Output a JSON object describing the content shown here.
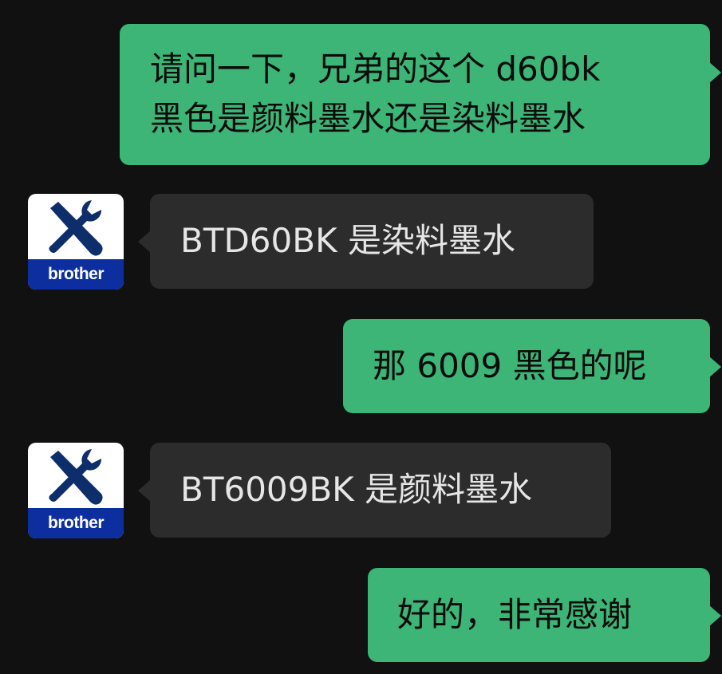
{
  "messages": [
    {
      "direction": "outgoing",
      "text": "请问一下，兄弟的这个 d60bk\n黑色是颜料墨水还是染料墨水"
    },
    {
      "direction": "incoming",
      "text": "BTD60BK 是染料墨水",
      "avatar_icon": "wrench-screwdriver-icon",
      "avatar_logo": "brother"
    },
    {
      "direction": "outgoing",
      "text": "那 6009 黑色的呢"
    },
    {
      "direction": "incoming",
      "text": "BT6009BK 是颜料墨水",
      "avatar_icon": "wrench-screwdriver-icon",
      "avatar_logo": "brother"
    },
    {
      "direction": "outgoing",
      "text": "好的，非常感谢"
    }
  ],
  "colors": {
    "background": "#111111",
    "outgoing_bubble": "#3db577",
    "incoming_bubble": "#2c2c2c",
    "brand_blue": "#0c2e9e"
  }
}
